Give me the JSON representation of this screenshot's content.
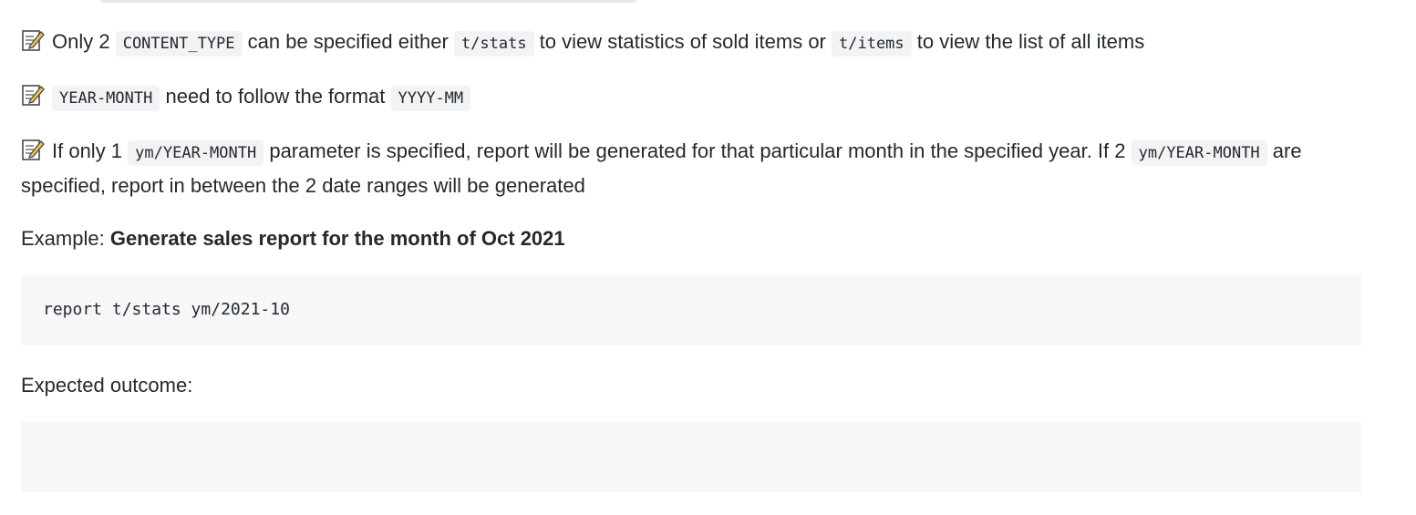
{
  "notes": [
    {
      "parts": [
        {
          "t": "text",
          "v": "Only 2 "
        },
        {
          "t": "code",
          "v": "CONTENT_TYPE"
        },
        {
          "t": "text",
          "v": " can be specified either "
        },
        {
          "t": "code",
          "v": "t/stats"
        },
        {
          "t": "text",
          "v": " to view statistics of sold items or "
        },
        {
          "t": "code",
          "v": "t/items"
        },
        {
          "t": "text",
          "v": " to view the list of all items"
        }
      ]
    },
    {
      "parts": [
        {
          "t": "code",
          "v": "YEAR-MONTH"
        },
        {
          "t": "text",
          "v": " need to follow the format "
        },
        {
          "t": "code",
          "v": "YYYY-MM"
        }
      ]
    },
    {
      "parts": [
        {
          "t": "text",
          "v": "If only 1 "
        },
        {
          "t": "code",
          "v": "ym/YEAR-MONTH"
        },
        {
          "t": "text",
          "v": " parameter is specified, report will be generated for that particular month in the specified year. If 2 "
        },
        {
          "t": "code",
          "v": "ym/YEAR-MONTH"
        },
        {
          "t": "text",
          "v": " are specified, report in between the 2 date ranges will be generated"
        }
      ]
    }
  ],
  "example": {
    "label": "Example: ",
    "title": "Generate sales report for the month of Oct 2021",
    "command": "report t/stats ym/2021-10"
  },
  "outcome": {
    "label": "Expected outcome:",
    "content": ""
  }
}
